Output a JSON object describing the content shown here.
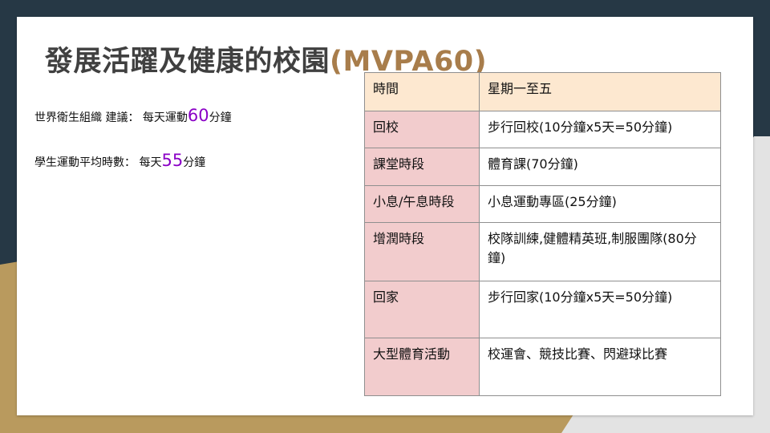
{
  "slide": {
    "title_main": "發展活躍及健康的校園",
    "title_accent": "(MVPA60)",
    "stats": [
      {
        "label": "世界衛生組織 建議： 每天運動",
        "value": "60",
        "unit": "分鐘"
      },
      {
        "label": "學生運動平均時數： 每天",
        "value": "55",
        "unit": "分鐘"
      }
    ],
    "table": {
      "header": [
        "時間",
        "星期一至五"
      ],
      "rows": [
        [
          "回校",
          "步行回校(10分鐘x5天=50分鐘)"
        ],
        [
          "課堂時段",
          "體育課(70分鐘)"
        ],
        [
          "小息/午息時段",
          "小息運動專區(25分鐘)"
        ],
        [
          "增潤時段",
          "校隊訓練,健體精英班,制服團隊(80分鐘)"
        ],
        [
          "回家",
          "步行回家(10分鐘x5天=50分鐘)"
        ],
        [
          "大型體育活動",
          "校運會、競技比賽、閃避球比賽"
        ]
      ]
    }
  },
  "colors": {
    "background_dark": "#263845",
    "background_gold": "#b99a5e",
    "background_grey": "#e3e3e3",
    "title_accent": "#a87d4b",
    "number_highlight": "#8a00c6",
    "header_cell": "#fde8d0",
    "label_cell": "#f2cccd"
  }
}
